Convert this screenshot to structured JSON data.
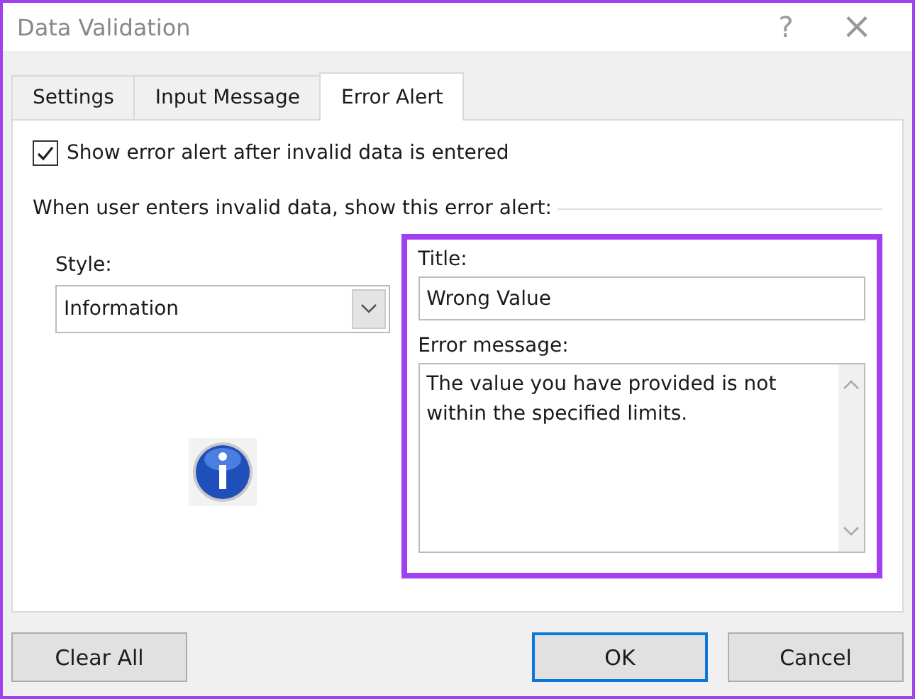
{
  "window": {
    "title": "Data Validation",
    "help": "?",
    "close": "×"
  },
  "tabs": [
    {
      "label": "Settings",
      "selected": false
    },
    {
      "label": "Input Message",
      "selected": false
    },
    {
      "label": "Error Alert",
      "selected": true
    }
  ],
  "show_alert": {
    "label": "Show error alert after invalid data is entered",
    "checked": true
  },
  "group_label": "When user enters invalid data, show this error alert:",
  "style": {
    "label": "Style:",
    "value": "Information",
    "kind": "information"
  },
  "alert_fields": {
    "highlighted": true,
    "title_label": "Title:",
    "title_value": "Wrong Value",
    "message_label": "Error message:",
    "message_value": "The value you have provided is not within the specified limits."
  },
  "buttons": [
    {
      "label": "Clear All",
      "kind": "left",
      "default": false
    },
    {
      "label": "OK",
      "kind": "right",
      "default": true
    },
    {
      "label": "Cancel",
      "kind": "right",
      "default": false
    }
  ]
}
